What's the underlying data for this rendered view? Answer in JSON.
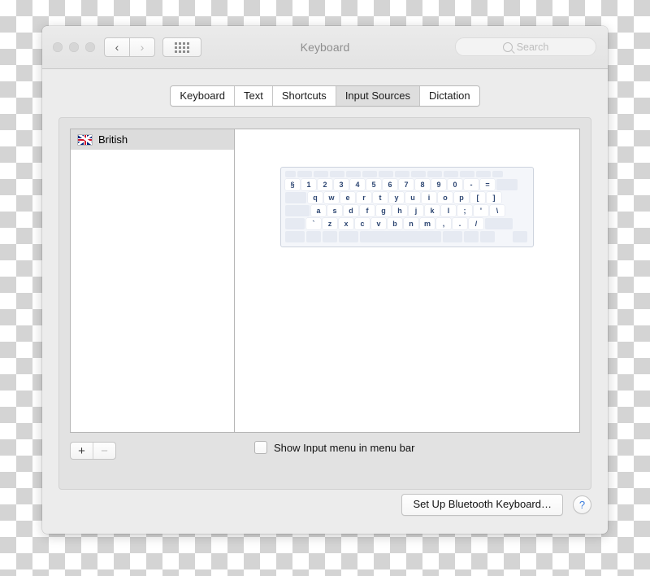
{
  "window": {
    "title": "Keyboard",
    "traffic_lights": [
      "close",
      "minimize",
      "zoom"
    ],
    "nav": {
      "back": "‹",
      "forward": "›"
    },
    "grid_button": "show-all-icon"
  },
  "search": {
    "placeholder": "Search",
    "value": "",
    "icon": "search-icon"
  },
  "tabs": [
    {
      "label": "Keyboard",
      "selected": false
    },
    {
      "label": "Text",
      "selected": false
    },
    {
      "label": "Shortcuts",
      "selected": false
    },
    {
      "label": "Input Sources",
      "selected": true
    },
    {
      "label": "Dictation",
      "selected": false
    }
  ],
  "source_list": {
    "items": [
      {
        "label": "British",
        "flag": "uk-flag-icon",
        "selected": true
      }
    ],
    "add_label": "+",
    "remove_label": "−"
  },
  "keyboard_preview": {
    "rows": [
      {
        "name": "function-row",
        "keys": [
          "",
          "",
          "",
          "",
          "",
          "",
          "",
          "",
          "",
          "",
          "",
          "",
          ""
        ]
      },
      {
        "name": "number-row",
        "keys": [
          "§",
          "1",
          "2",
          "3",
          "4",
          "5",
          "6",
          "7",
          "8",
          "9",
          "0",
          "-",
          "="
        ]
      },
      {
        "name": "qwerty-row",
        "keys": [
          "q",
          "w",
          "e",
          "r",
          "t",
          "y",
          "u",
          "i",
          "o",
          "p",
          "[",
          "]"
        ]
      },
      {
        "name": "home-row",
        "keys": [
          "a",
          "s",
          "d",
          "f",
          "g",
          "h",
          "j",
          "k",
          "l",
          ";",
          "'",
          "\\"
        ]
      },
      {
        "name": "bottom-row",
        "keys": [
          "`",
          "z",
          "x",
          "c",
          "v",
          "b",
          "n",
          "m",
          ",",
          ".",
          "/"
        ]
      },
      {
        "name": "modifier-row",
        "keys": [
          "",
          "",
          "",
          "",
          "",
          "",
          "",
          ""
        ]
      }
    ]
  },
  "options": {
    "show_input_menu": {
      "label": "Show Input menu in menu bar",
      "checked": false
    }
  },
  "footer": {
    "bluetooth_button": "Set Up Bluetooth Keyboard…",
    "help_button": "?"
  },
  "colors": {
    "accent_blue": "#3b7ddd",
    "key_text": "#2d4672",
    "selected_row": "#dcdcdc",
    "flag_blue": "#00247d",
    "flag_red": "#cf142b"
  }
}
